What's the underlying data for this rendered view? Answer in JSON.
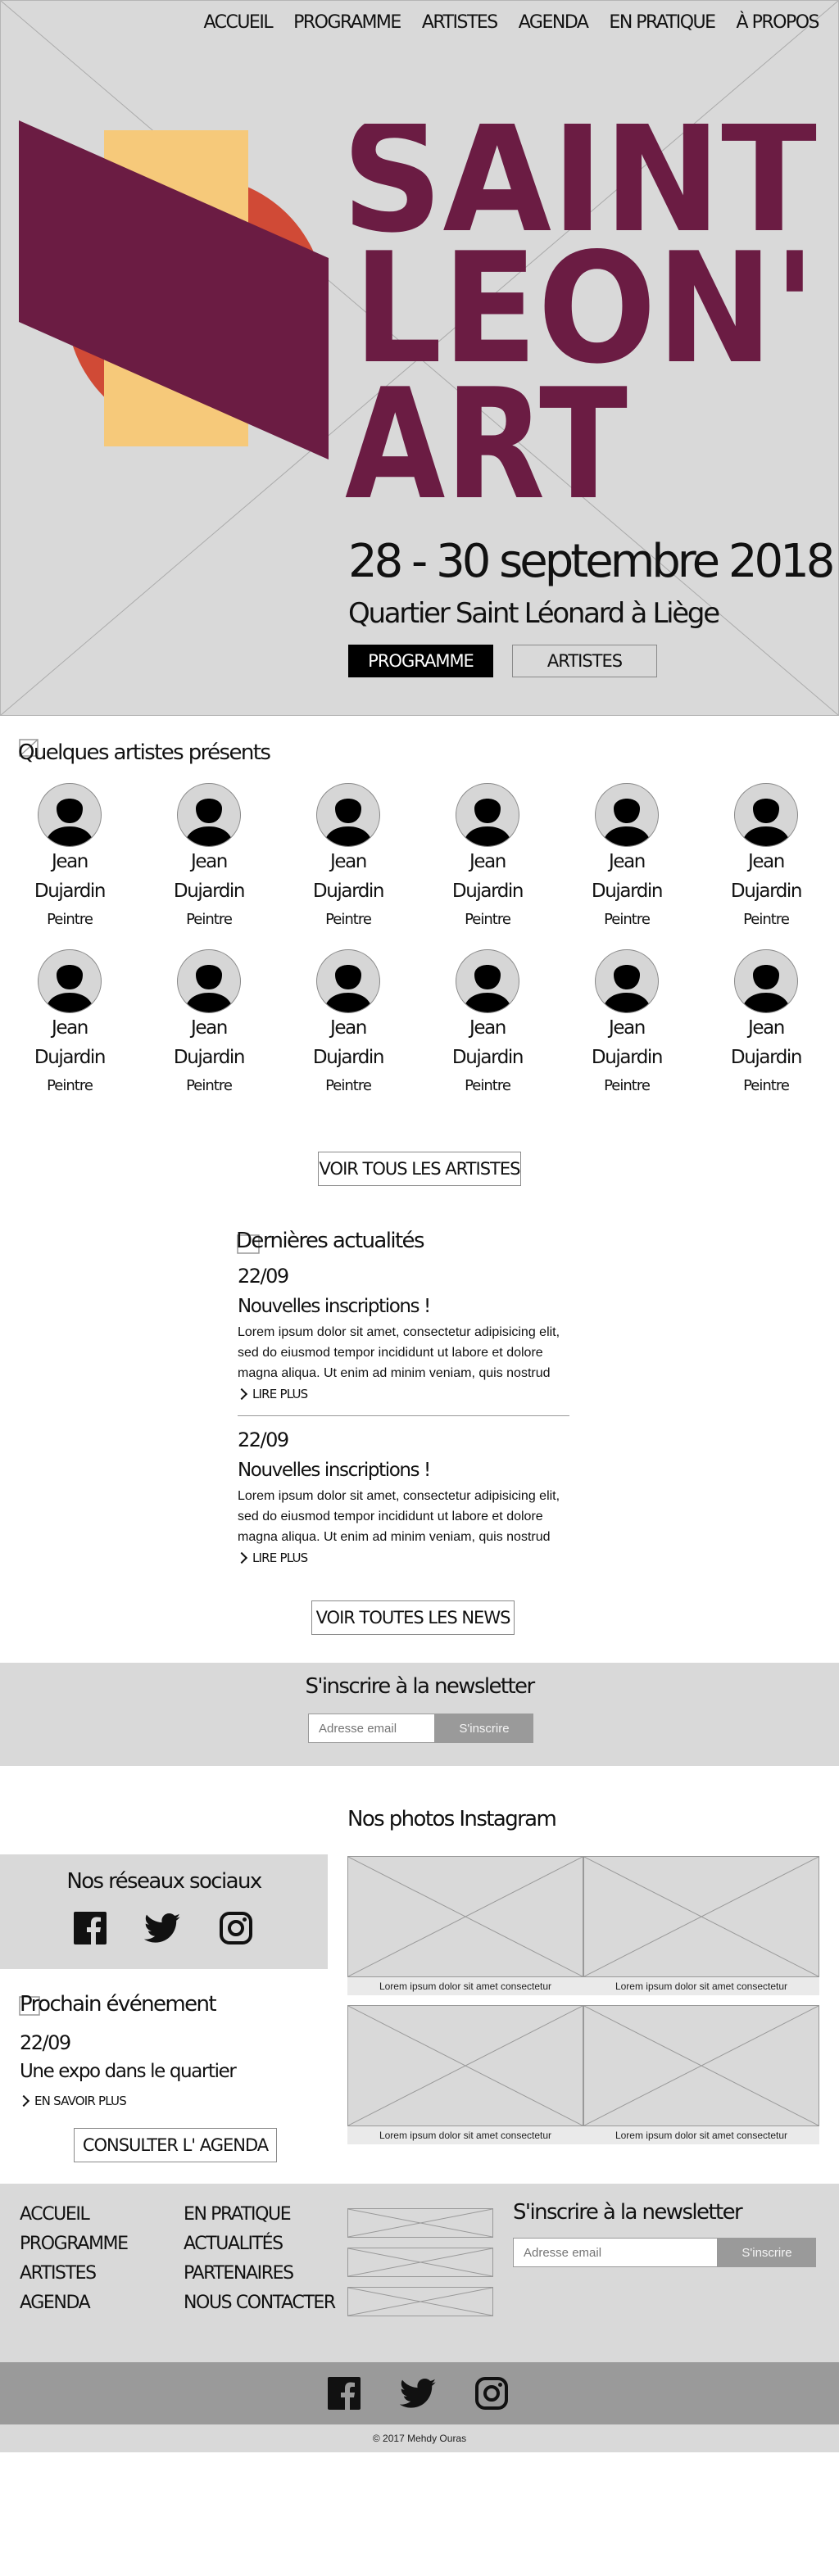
{
  "nav": {
    "items": [
      "ACCUEIL",
      "PROGRAMME",
      "ARTISTES",
      "AGENDA",
      "EN PRATIQUE",
      "À PROPOS"
    ]
  },
  "hero": {
    "logo_line1": "SAINT",
    "logo_line2": "LEON'",
    "logo_line3": "ART",
    "dates": "28 - 30 septembre 2018",
    "location": "Quartier Saint Léonard à Liège",
    "btn_program": "PROGRAMME",
    "btn_artists": "ARTISTES",
    "colors": {
      "wine": "#6b1c43",
      "orange": "#d04a36",
      "yellow": "#f6c97a"
    }
  },
  "artists": {
    "title": "Quelques artistes présents",
    "list": [
      {
        "first": "Jean",
        "last": "Dujardin",
        "role": "Peintre"
      },
      {
        "first": "Jean",
        "last": "Dujardin",
        "role": "Peintre"
      },
      {
        "first": "Jean",
        "last": "Dujardin",
        "role": "Peintre"
      },
      {
        "first": "Jean",
        "last": "Dujardin",
        "role": "Peintre"
      },
      {
        "first": "Jean",
        "last": "Dujardin",
        "role": "Peintre"
      },
      {
        "first": "Jean",
        "last": "Dujardin",
        "role": "Peintre"
      },
      {
        "first": "Jean",
        "last": "Dujardin",
        "role": "Peintre"
      },
      {
        "first": "Jean",
        "last": "Dujardin",
        "role": "Peintre"
      },
      {
        "first": "Jean",
        "last": "Dujardin",
        "role": "Peintre"
      },
      {
        "first": "Jean",
        "last": "Dujardin",
        "role": "Peintre"
      },
      {
        "first": "Jean",
        "last": "Dujardin",
        "role": "Peintre"
      },
      {
        "first": "Jean",
        "last": "Dujardin",
        "role": "Peintre"
      }
    ],
    "all_button": "VOIR TOUS LES ARTISTES"
  },
  "news": {
    "title": "Dernières actualités",
    "items": [
      {
        "date": "22/09",
        "title": "Nouvelles inscriptions !",
        "line1": "Lorem ipsum dolor sit amet, consectetur adipisicing elit,",
        "line2": "sed do eiusmod tempor incididunt ut labore et dolore",
        "line3": "magna aliqua. Ut enim ad minim veniam, quis nostrud",
        "more": "LIRE PLUS"
      },
      {
        "date": "22/09",
        "title": "Nouvelles inscriptions !",
        "line1": "Lorem ipsum dolor sit amet, consectetur adipisicing elit,",
        "line2": "sed do eiusmod tempor incididunt ut labore et dolore",
        "line3": "magna aliqua. Ut enim ad minim veniam, quis nostrud",
        "more": "LIRE PLUS"
      }
    ],
    "all_button": "VOIR TOUTES LES NEWS"
  },
  "newsletter": {
    "title": "S'inscrire à la newsletter",
    "placeholder": "Adresse email",
    "button": "S'inscrire"
  },
  "instagram": {
    "title": "Nos photos Instagram",
    "captions": [
      "Lorem ipsum dolor sit amet consectetur",
      "Lorem ipsum dolor sit amet consectetur",
      "Lorem ipsum dolor sit amet consectetur",
      "Lorem ipsum dolor sit amet consectetur"
    ]
  },
  "social": {
    "title": "Nos réseaux sociaux",
    "icons": [
      "facebook-icon",
      "twitter-icon",
      "instagram-icon"
    ]
  },
  "event": {
    "title": "Prochain événement",
    "date": "22/09",
    "name": "Une expo dans le quartier",
    "more": "EN SAVOIR PLUS",
    "agenda_button": "CONSULTER L' AGENDA"
  },
  "footer": {
    "col1": [
      "ACCUEIL",
      "PROGRAMME",
      "ARTISTES",
      "AGENDA"
    ],
    "col2": [
      "EN PRATIQUE",
      "ACTUALITÉS",
      "PARTENAIRES",
      "NOUS CONTACTER"
    ],
    "newsletter_title": "S'inscrire à la newsletter",
    "placeholder": "Adresse email",
    "button": "S'inscrire",
    "copyright": "© 2017 Mehdy Ouras"
  }
}
